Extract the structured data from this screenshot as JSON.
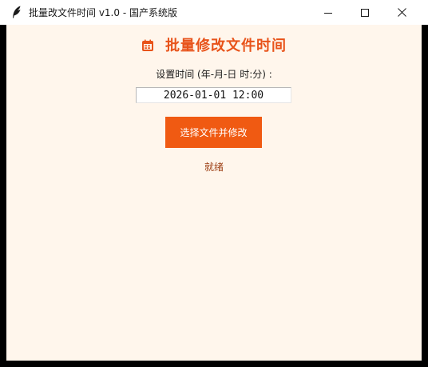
{
  "window": {
    "title": "批量改文件时间  v1.0  -  国产系统版",
    "app_icon": "feather-icon",
    "controls": {
      "minimize_icon": "minimize-icon",
      "maximize_icon": "maximize-icon",
      "close_icon": "close-icon"
    }
  },
  "main": {
    "heading_icon": "calendar-icon",
    "heading": "批量修改文件时间",
    "time_label": "设置时间 (年-月-日 时:分) :",
    "time_value": "2026-01-01 12:00",
    "action_button": "选择文件并修改",
    "status": "就绪"
  },
  "colors": {
    "accent": "#e8531a",
    "button_bg": "#f05a12",
    "background": "#fff6ec",
    "status_text": "#9c3d12"
  }
}
